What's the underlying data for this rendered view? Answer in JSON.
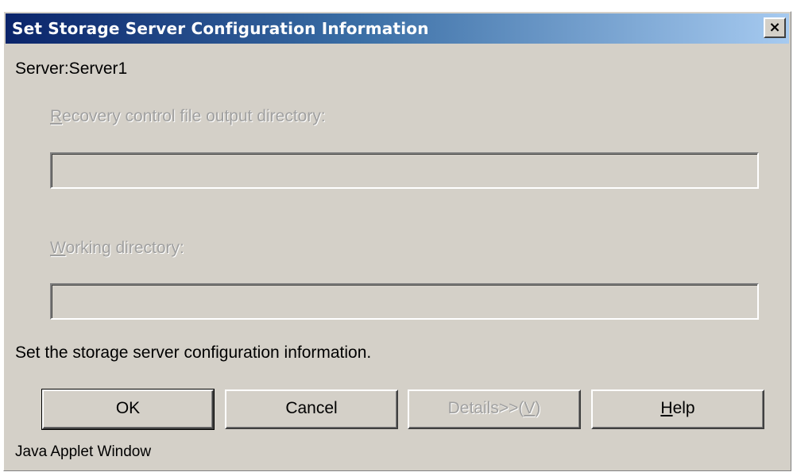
{
  "window": {
    "title": "Set Storage Server Configuration Information",
    "close_label": "×"
  },
  "server": {
    "label": "Server:Server1"
  },
  "recovery_dir": {
    "mnemonic": "R",
    "label_rest": "ecovery control file output directory:",
    "value": "",
    "enabled": false
  },
  "working_dir": {
    "mnemonic": "W",
    "label_rest": "orking directory:",
    "value": "",
    "enabled": false
  },
  "message": "Set the storage server configuration information.",
  "buttons": {
    "ok": "OK",
    "cancel": "Cancel",
    "details": {
      "prefix": "Details>>(",
      "mnemonic": "V",
      "suffix": ")",
      "enabled": false
    },
    "help": {
      "mnemonic": "H",
      "rest": "elp"
    }
  },
  "footer": "Java Applet Window",
  "colors": {
    "dialog_bg": "#d4d0c8",
    "title_gradient_start": "#0a246a",
    "title_gradient_end": "#a6caf0",
    "disabled_text": "#a0a0a0"
  }
}
